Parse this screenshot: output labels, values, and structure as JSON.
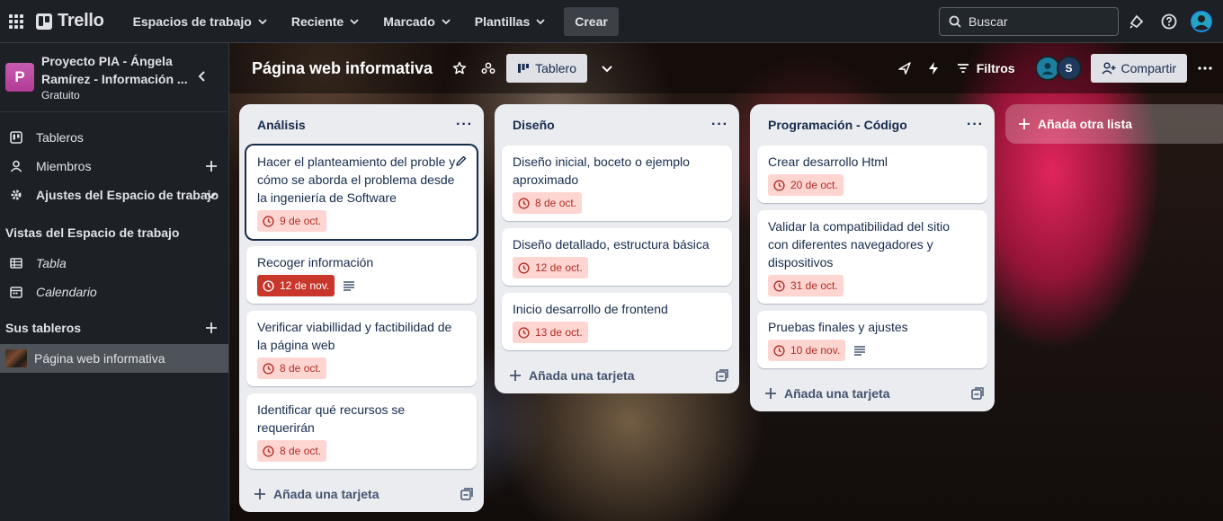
{
  "topbar": {
    "logo_text": "Trello",
    "nav": [
      {
        "label": "Espacios de trabajo"
      },
      {
        "label": "Reciente"
      },
      {
        "label": "Marcado"
      },
      {
        "label": "Plantillas"
      }
    ],
    "create_label": "Crear",
    "search_placeholder": "Buscar"
  },
  "workspace": {
    "avatar_letter": "P",
    "name": "Proyecto PIA - Ángela Ramírez - Información ...",
    "plan": "Gratuito",
    "menu": [
      {
        "label": "Tableros",
        "icon": "boards-icon"
      },
      {
        "label": "Miembros",
        "icon": "members-icon"
      },
      {
        "label": "Ajustes del Espacio de trabajo",
        "icon": "settings-icon"
      }
    ],
    "views_title": "Vistas del Espacio de trabajo",
    "views": [
      {
        "label": "Tabla",
        "icon": "table-icon"
      },
      {
        "label": "Calendario",
        "icon": "calendar-icon"
      }
    ],
    "boards_title": "Sus tableros",
    "boards": [
      {
        "label": "Página web informativa"
      }
    ]
  },
  "board": {
    "title": "Página web informativa",
    "view_label": "Tablero",
    "filters_label": "Filtros",
    "member_initial": "S",
    "share_label": "Compartir",
    "add_list_label": "Añada otra lista"
  },
  "lists": [
    {
      "title": "Análisis",
      "add_card_label": "Añada una tarjeta",
      "cards": [
        {
          "title": "Hacer el planteamiento del proble y cómo se aborda el problema desde la ingeniería de Software",
          "due": "9 de oct."
        },
        {
          "title": "Recoger información",
          "due": "12 de nov."
        },
        {
          "title": "Verificar viabillidad y factibilidad de la página web",
          "due": "8 de oct."
        },
        {
          "title": "Identificar qué recursos se requerirán",
          "due": "8 de oct."
        }
      ]
    },
    {
      "title": "Diseño",
      "add_card_label": "Añada una tarjeta",
      "cards": [
        {
          "title": "Diseño inicial, boceto o ejemplo aproximado",
          "due": "8 de oct."
        },
        {
          "title": "Diseño detallado, estructura básica",
          "due": "12 de oct."
        },
        {
          "title": "Inicio desarrollo de frontend",
          "due": "13 de oct."
        }
      ]
    },
    {
      "title": "Programación - Código",
      "add_card_label": "Añada una tarjeta",
      "cards": [
        {
          "title": "Crear desarrollo Html",
          "due": "20 de oct."
        },
        {
          "title": "Validar la compatibilidad del sitio con diferentes navegadores y dispositivos",
          "due": "31 de oct."
        },
        {
          "title": "Pruebas finales y ajustes",
          "due": "10 de nov."
        }
      ]
    }
  ],
  "colors": {
    "due_bg": "#ffd5d2",
    "due_text": "#ae2e24",
    "overdue_bg": "#c9372c",
    "list_bg": "#ebecf0",
    "topbar_bg": "#1d2125"
  }
}
